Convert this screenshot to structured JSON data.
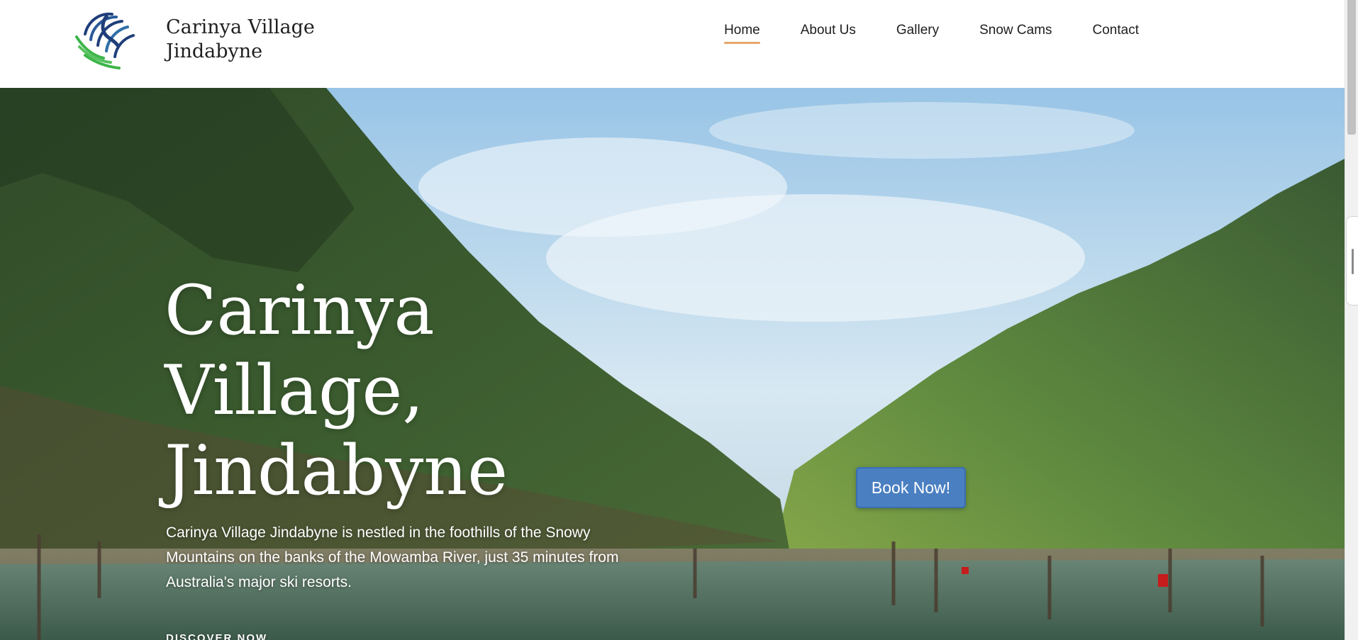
{
  "header": {
    "logo_icon": "peacock-logo-icon",
    "logo_line1": "Carinya Village",
    "logo_line2": "Jindabyne"
  },
  "nav": {
    "items": [
      {
        "label": "Home",
        "active": true
      },
      {
        "label": "About Us",
        "active": false
      },
      {
        "label": "Gallery",
        "active": false
      },
      {
        "label": "Snow Cams",
        "active": false
      },
      {
        "label": "Contact",
        "active": false
      }
    ]
  },
  "hero": {
    "title_line1": "Carinya",
    "title_line2": "Village,",
    "title_line3": "Jindabyne",
    "description": "Carinya Village Jindabyne is nestled in the foothills of the Snowy Mountains on the banks of the Mowamba River, just 35 minutes from Australia's major ski resorts.",
    "discover_label": "DISCOVER NOW",
    "book_label": "Book Now!"
  },
  "colors": {
    "nav_active_underline": "#e8a76b",
    "book_button": "#4a7fc1",
    "logo_blue": "#1f3f7a",
    "logo_green": "#3db54a"
  }
}
